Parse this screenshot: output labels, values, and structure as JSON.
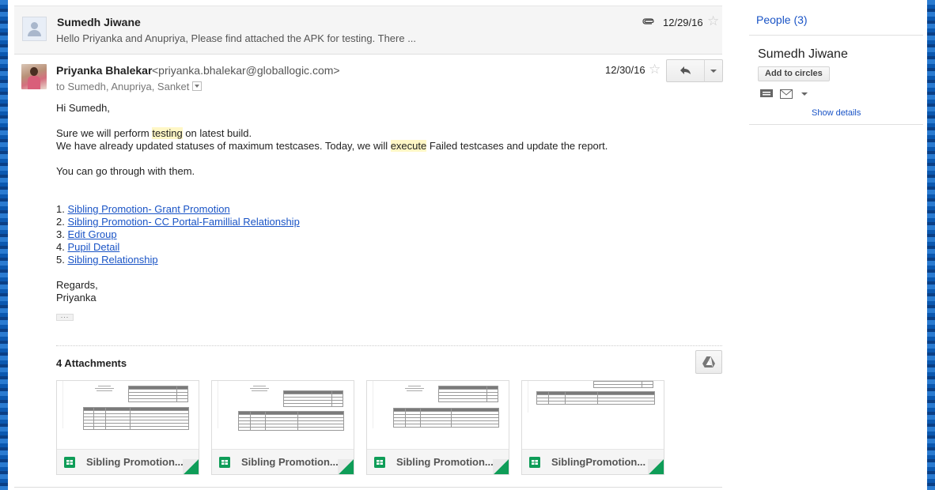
{
  "collapsed_message": {
    "sender": "Sumedh Jiwane",
    "snippet": "Hello Priyanka and Anupriya, Please find attached the APK for testing. There ...",
    "date": "12/29/16"
  },
  "message": {
    "from_name": "Priyanka Bhalekar",
    "from_email": "<priyanka.bhalekar@globallogic.com>",
    "to_line": "to Sumedh, Anupriya, Sanket",
    "date": "12/30/16",
    "greeting": "Hi Sumedh,",
    "line1_pre": "Sure we will perform ",
    "line1_hl": "testing",
    "line1_post": " on latest build.",
    "line2_pre": "We have already updated statuses of maximum testcases. Today, we will ",
    "line2_hl": "execute",
    "line2_post": " Failed testcases and update the report.",
    "line3": "You can go through with them.",
    "links": [
      {
        "num": "1. ",
        "text": "Sibling Promotion- Grant Promotion"
      },
      {
        "num": "2. ",
        "text": "Sibling Promotion- CC Portal-Famillial Relationship"
      },
      {
        "num": "3. ",
        "text": "Edit Group"
      },
      {
        "num": "4. ",
        "text": "Pupil Detail"
      },
      {
        "num": "5. ",
        "text": " Sibling Relationship"
      }
    ],
    "regards": "Regards,",
    "signature": "Priyanka",
    "trimmed_indicator": "..."
  },
  "attachments": {
    "title": "4 Attachments",
    "files": [
      {
        "name": "Sibling Promotion..."
      },
      {
        "name": "Sibling Promotion..."
      },
      {
        "name": "Sibling Promotion..."
      },
      {
        "name": "SiblingPromotion..."
      }
    ]
  },
  "sidebar": {
    "people": "People (3)",
    "contact_name": "Sumedh Jiwane",
    "add_to_circles": "Add to circles",
    "show_details": "Show details"
  },
  "icons": {
    "star": "star-icon",
    "attachment": "paperclip-icon",
    "reply": "reply-icon",
    "drive": "google-drive-icon",
    "sheets": "google-sheets-icon",
    "message": "chat-icon",
    "mail": "mail-icon"
  },
  "colors": {
    "link": "#1a54c6",
    "highlight": "#fff7c6",
    "sheets_green": "#0f9d58"
  }
}
